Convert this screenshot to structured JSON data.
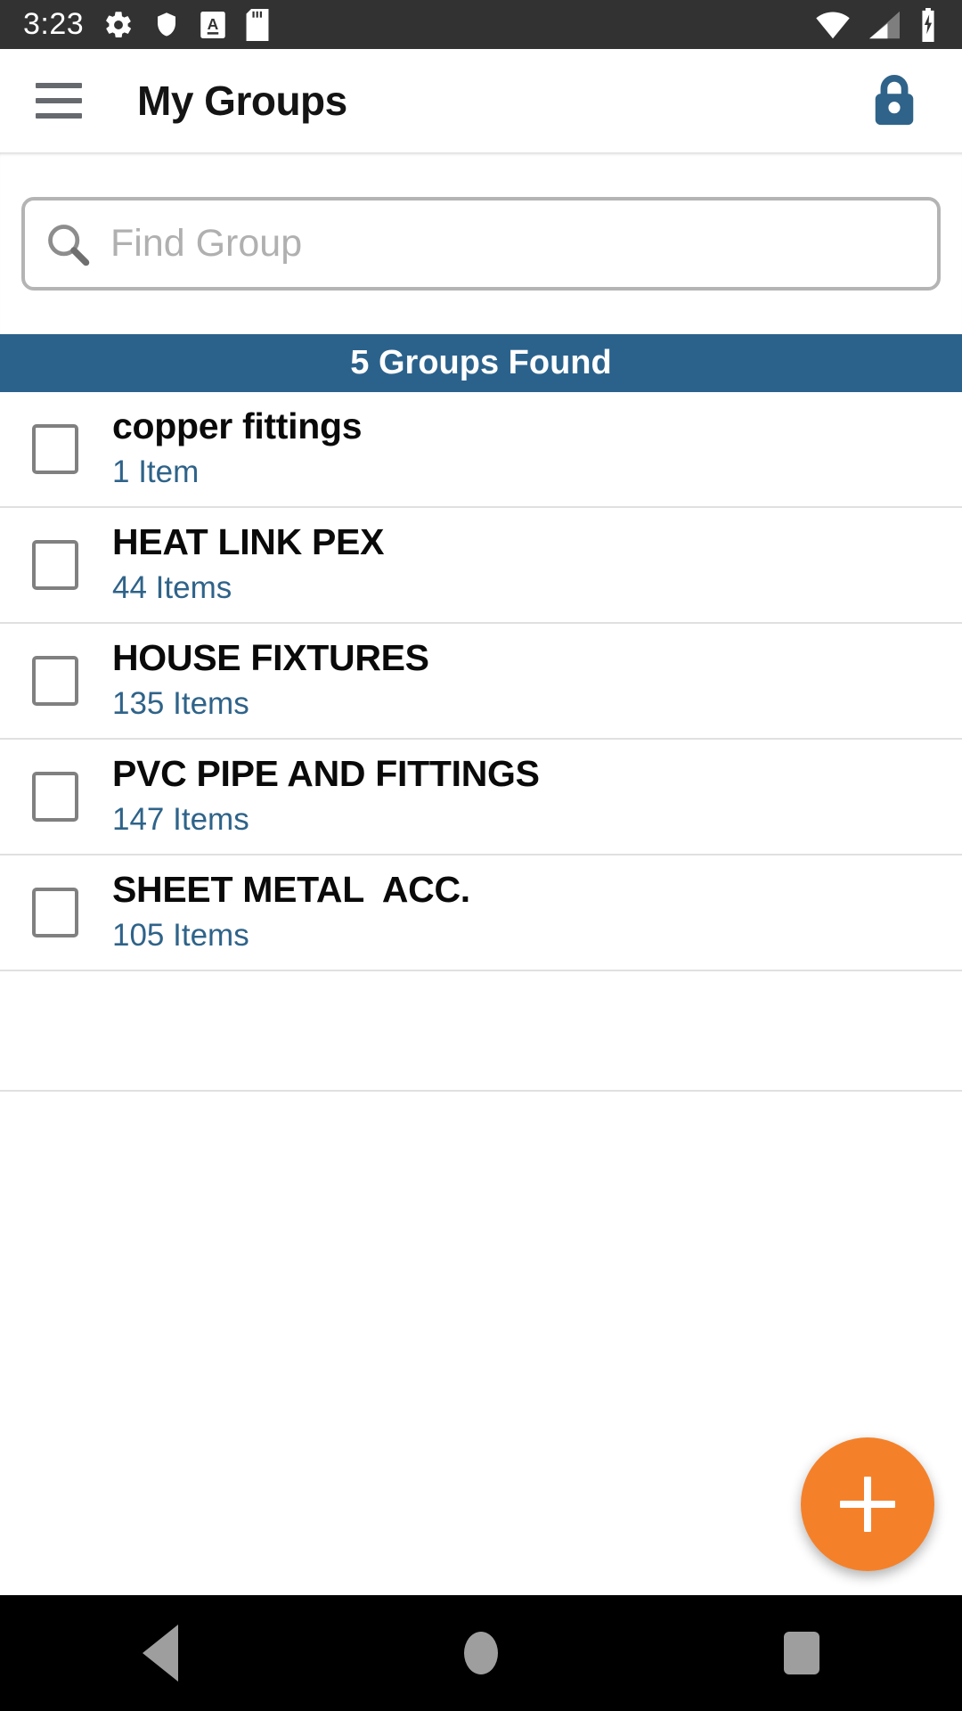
{
  "status_bar": {
    "time": "3:23",
    "left_icons": [
      "gear-icon",
      "shield-icon",
      "letter-a-badge-icon",
      "sd-card-icon"
    ],
    "right_icons": [
      "wifi-icon",
      "cell-signal-icon",
      "battery-charging-icon"
    ],
    "background_color": "#323232"
  },
  "app_bar": {
    "menu_icon": "hamburger-menu-icon",
    "title": "My Groups",
    "lock_icon": "lock-closed-icon",
    "lock_color": "#2f6389"
  },
  "search": {
    "icon": "search-icon",
    "placeholder": "Find Group",
    "value": ""
  },
  "result_banner": {
    "text": "5 Groups Found",
    "background_color": "#2b628c",
    "text_color": "#ffffff"
  },
  "groups": [
    {
      "name": "copper fittings",
      "count_label": "1 Item",
      "checked": false
    },
    {
      "name": "HEAT LINK PEX",
      "count_label": "44 Items",
      "checked": false
    },
    {
      "name": "HOUSE FIXTURES",
      "count_label": "135 Items",
      "checked": false
    },
    {
      "name": "PVC PIPE AND FITTINGS",
      "count_label": "147 Items",
      "checked": false
    },
    {
      "name": "SHEET METAL  ACC.",
      "count_label": "105 Items",
      "checked": false
    }
  ],
  "fab": {
    "icon": "plus-icon",
    "color": "#f4812a"
  },
  "nav_bar": {
    "back": "back-triangle-icon",
    "home": "home-circle-icon",
    "recents": "recents-square-icon"
  }
}
